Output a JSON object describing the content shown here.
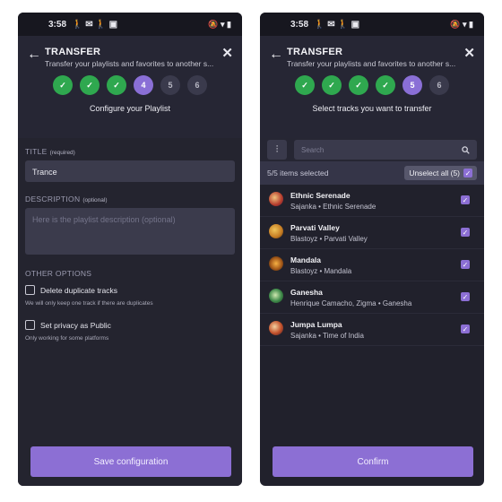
{
  "status": {
    "time": "3:58",
    "left_icons": "🚶 ✉ 🚶 ▣",
    "right_icons": "🔕 ▾ ▮"
  },
  "left": {
    "title": "TRANSFER",
    "subtitle": "Transfer your playlists and favorites to another s...",
    "steps": [
      "✓",
      "✓",
      "✓",
      "4",
      "5",
      "6"
    ],
    "caption": "Configure your Playlist",
    "title_label": "TITLE",
    "title_required": "(required)",
    "title_value": "Trance",
    "description_label": "DESCRIPTION",
    "description_optional": "(optional)",
    "description_placeholder": "Here is the playlist description (optional)",
    "other_options_label": "OTHER OPTIONS",
    "option1_label": "Delete duplicate tracks",
    "option1_hint": "We will only keep one track if there are duplicates",
    "option2_label": "Set privacy as Public",
    "option2_hint": "Only working for some platforms",
    "button_label": "Save configuration"
  },
  "right": {
    "title": "TRANSFER",
    "subtitle": "Transfer your playlists and favorites to another s...",
    "steps": [
      "✓",
      "✓",
      "✓",
      "✓",
      "5",
      "6"
    ],
    "caption": "Select tracks you want to transfer",
    "search_placeholder": "Search",
    "selection_count": "5/5 items selected",
    "unselect_label": "Unselect all (5)",
    "tracks": [
      {
        "title": "Ethnic Serenade",
        "subtitle": "Sajanka • Ethnic Serenade"
      },
      {
        "title": "Parvati Valley",
        "subtitle": "Blastoyz • Parvati Valley"
      },
      {
        "title": "Mandala",
        "subtitle": "Blastoyz • Mandala"
      },
      {
        "title": "Ganesha",
        "subtitle": "Henrique Camacho, Zigma • Ganesha"
      },
      {
        "title": "Jumpa Lumpa",
        "subtitle": "Sajanka • Time of India"
      }
    ],
    "button_label": "Confirm"
  },
  "icons": {
    "back": "arrow-left-icon",
    "close": "close-icon",
    "check": "check-icon",
    "filter": "sliders-icon",
    "search": "search-icon"
  },
  "colors": {
    "accent": "#8c6fd4",
    "done": "#2fa84f",
    "background": "#21212c"
  }
}
